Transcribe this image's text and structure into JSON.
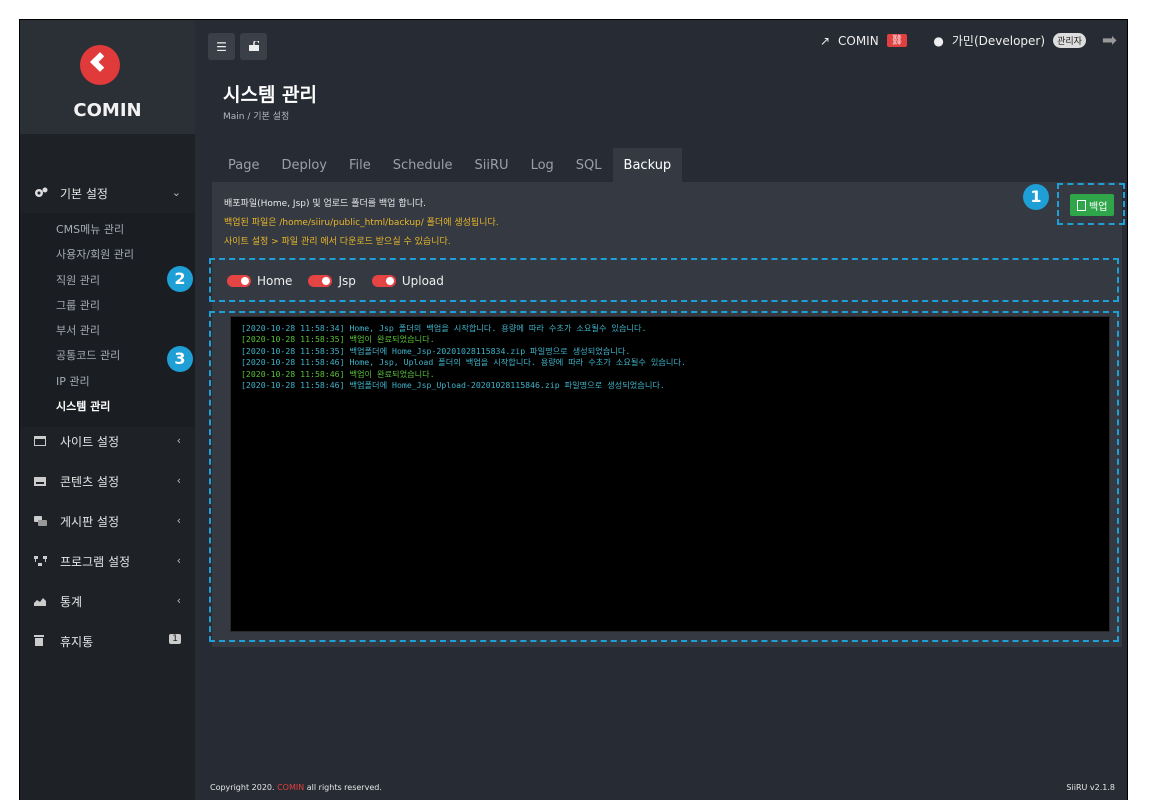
{
  "brand": {
    "name": "COMIN",
    "accent": "#e03a3a"
  },
  "header": {
    "site_link": "COMIN",
    "user": "가민(Developer)",
    "role": "관리자"
  },
  "page": {
    "title": "시스템 관리",
    "breadcrumb": "Main / 기본 설정"
  },
  "sidebar": {
    "groups": [
      {
        "label": "기본 설정",
        "icon": "gears-icon",
        "expanded": true,
        "items": [
          "CMS메뉴 관리",
          "사용자/회원 관리",
          "직원 관리",
          "그룹 관리",
          "부서 관리",
          "공통코드 관리",
          "IP 관리",
          "시스템 관리"
        ],
        "active": "시스템 관리"
      },
      {
        "label": "사이트 설정",
        "icon": "window-icon"
      },
      {
        "label": "콘텐츠 설정",
        "icon": "keyboard-icon"
      },
      {
        "label": "게시판 설정",
        "icon": "comments-icon"
      },
      {
        "label": "프로그램 설정",
        "icon": "sitemap-icon"
      },
      {
        "label": "통계",
        "icon": "area-chart-icon"
      },
      {
        "label": "휴지통",
        "icon": "trash-icon",
        "badge": "1"
      }
    ]
  },
  "tabs": [
    "Page",
    "Deploy",
    "File",
    "Schedule",
    "SiiRU",
    "Log",
    "SQL",
    "Backup"
  ],
  "active_tab": "Backup",
  "notice": {
    "line1": "배포파일(Home, Jsp) 및 업로드 폴더를 백업 합니다.",
    "line2": "백업된 파일은 /home/siiru/public_html/backup/ 폴더에 생성됩니다.",
    "line3": "사이트 설정 > 파일 관리 에서 다운로드 받으실 수 있습니다."
  },
  "backup_button": "백업",
  "toggles": [
    {
      "label": "Home",
      "on": true
    },
    {
      "label": "Jsp",
      "on": true
    },
    {
      "label": "Upload",
      "on": true
    }
  ],
  "console_lines": [
    {
      "text": "[2020-10-28 11:58:34] Home, Jsp 폴더의 백업을 시작합니다. 용량에 따라 수초가 소요될수 있습니다.",
      "color": "#3fb3c9"
    },
    {
      "text": "[2020-10-28 11:58:35] 백업이 완료되었습니다.",
      "color": "#59c13a"
    },
    {
      "text": "[2020-10-28 11:58:35] 백업폴더에 Home_Jsp-20201028115834.zip 파일명으로 생성되었습니다.",
      "color": "#3fb3c9"
    },
    {
      "text": "[2020-10-28 11:58:46] Home, Jsp, Upload 폴더의 백업을 시작합니다. 용량에 따라 수초가 소요될수 있습니다.",
      "color": "#3fb3c9"
    },
    {
      "text": "[2020-10-28 11:58:46] 백업이 완료되었습니다.",
      "color": "#59c13a"
    },
    {
      "text": "[2020-10-28 11:58:46] 백업폴더에 Home_Jsp_Upload-20201028115846.zip 파일명으로 생성되었습니다.",
      "color": "#3fb3c9"
    }
  ],
  "callouts": [
    "1",
    "2",
    "3"
  ],
  "footer": {
    "copyright_pre": "Copyright 2020.",
    "copyright_brand": "COMIN",
    "copyright_post": "all rights reserved.",
    "version": "SiiRU v2.1.8"
  }
}
